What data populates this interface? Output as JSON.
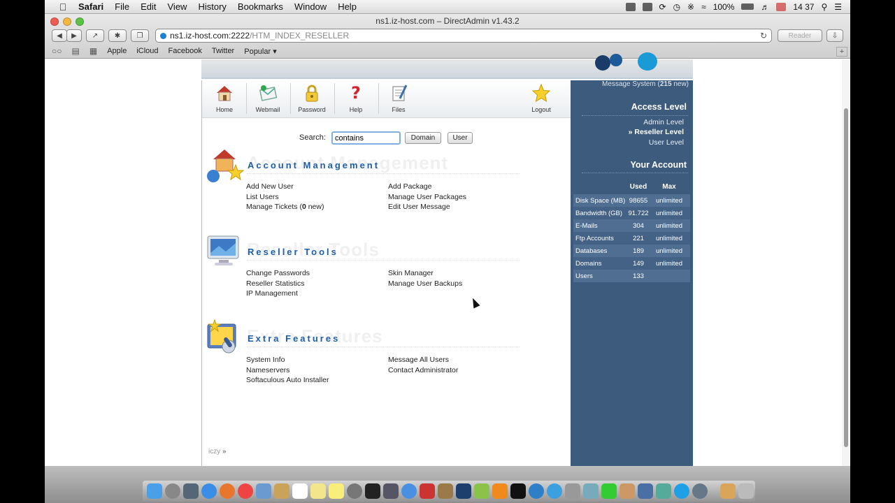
{
  "menubar": {
    "app": "Safari",
    "items": [
      "File",
      "Edit",
      "View",
      "History",
      "Bookmarks",
      "Window",
      "Help"
    ],
    "battery": "100%",
    "clock": "14 37"
  },
  "browser": {
    "window_title": "ns1.iz-host.com – DirectAdmin v1.43.2",
    "url_host": "ns1.iz-host.com:2222",
    "url_path": "/HTM_INDEX_RESELLER",
    "reader_label": "Reader",
    "bookmarks": [
      "Apple",
      "iCloud",
      "Facebook",
      "Twitter",
      "Popular ▾"
    ]
  },
  "toolbar": {
    "home": "Home",
    "webmail": "Webmail",
    "password": "Password",
    "help": "Help",
    "files": "Files",
    "logout": "Logout"
  },
  "search": {
    "label": "Search:",
    "value": "contains",
    "domain_button": "Domain",
    "user_button": "User"
  },
  "sections": {
    "account": {
      "title": "Account Management",
      "left": [
        "Add New User",
        "List Users",
        "Manage Tickets ("
      ],
      "tickets_count": "0",
      "tickets_suffix": " new)",
      "right": [
        "Add Package",
        "Manage User Packages",
        "Edit User Message"
      ]
    },
    "reseller": {
      "title": "Reseller Tools",
      "left": [
        "Change Passwords",
        "Reseller Statistics",
        "IP Management"
      ],
      "right": [
        "Skin Manager",
        "Manage User Backups"
      ]
    },
    "extra": {
      "title": "Extra Features",
      "left": [
        "System Info",
        "Nameservers",
        "Softaculous Auto Installer"
      ],
      "right": [
        "Message All Users",
        "Contact Administrator"
      ]
    }
  },
  "footer": {
    "iczy": "iczy",
    "arrow": "»"
  },
  "sidebar": {
    "message_system": "Message System (",
    "message_count": "215",
    "message_suffix": " new)",
    "access_level_title": "Access Level",
    "levels": [
      "Admin Level",
      "» Reseller Level",
      "User Level"
    ],
    "account_title": "Your Account",
    "col_used": "Used",
    "col_max": "Max",
    "stats": [
      {
        "label": "Disk Space (MB)",
        "used": "98655",
        "max": "unlimited"
      },
      {
        "label": "Bandwidth (GB)",
        "used": "91.722",
        "max": "unlimited"
      },
      {
        "label": "E-Mails",
        "used": "304",
        "max": "unlimited"
      },
      {
        "label": "Ftp Accounts",
        "used": "221",
        "max": "unlimited"
      },
      {
        "label": "Databases",
        "used": "189",
        "max": "unlimited"
      },
      {
        "label": "Domains",
        "used": "149",
        "max": "unlimited"
      },
      {
        "label": "Users",
        "used": "133",
        "max": ""
      }
    ]
  },
  "colors": {
    "sidebar_bg": "#3c5b7d",
    "section_title": "#1e5fa8"
  }
}
